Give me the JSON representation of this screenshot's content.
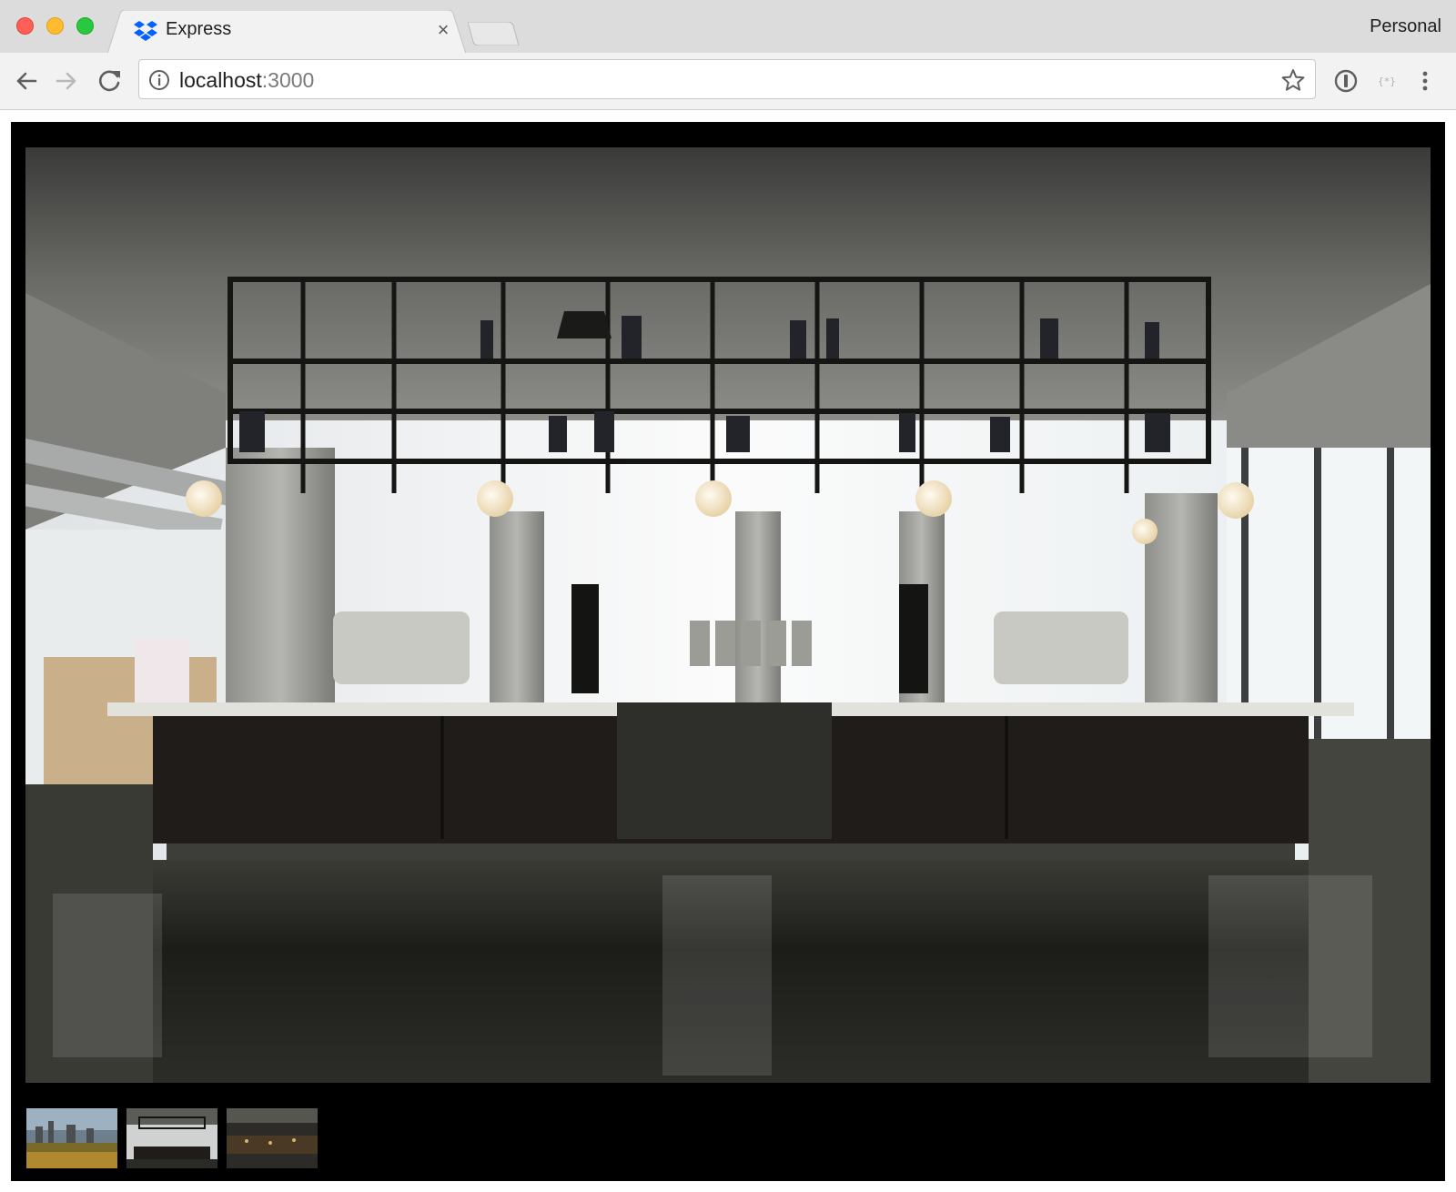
{
  "browser": {
    "tab": {
      "title": "Express",
      "favicon": "dropbox-icon"
    },
    "profile_name": "Personal",
    "address_bar": {
      "host": "localhost",
      "port": ":3000",
      "security_icon": "info-icon"
    },
    "buttons": {
      "back": "back-arrow-icon",
      "forward": "forward-arrow-icon",
      "reload": "reload-icon",
      "bookmark": "star-icon",
      "menu": "kebab-menu-icon"
    },
    "extensions": [
      "onepassword-icon",
      "extension-icon"
    ]
  },
  "gallery": {
    "main_image": {
      "subject": "cafe coffee bar interior",
      "selected_index": 1
    },
    "thumbnails": [
      {
        "subject": "city skyline at sunset"
      },
      {
        "subject": "cafe coffee bar interior"
      },
      {
        "subject": "dark restaurant interior"
      }
    ]
  },
  "colors": {
    "tabstrip_bg": "#dcdcdc",
    "toolbar_bg": "#f2f2f2",
    "viewer_bg": "#000000",
    "dropbox_blue": "#0061fe"
  }
}
